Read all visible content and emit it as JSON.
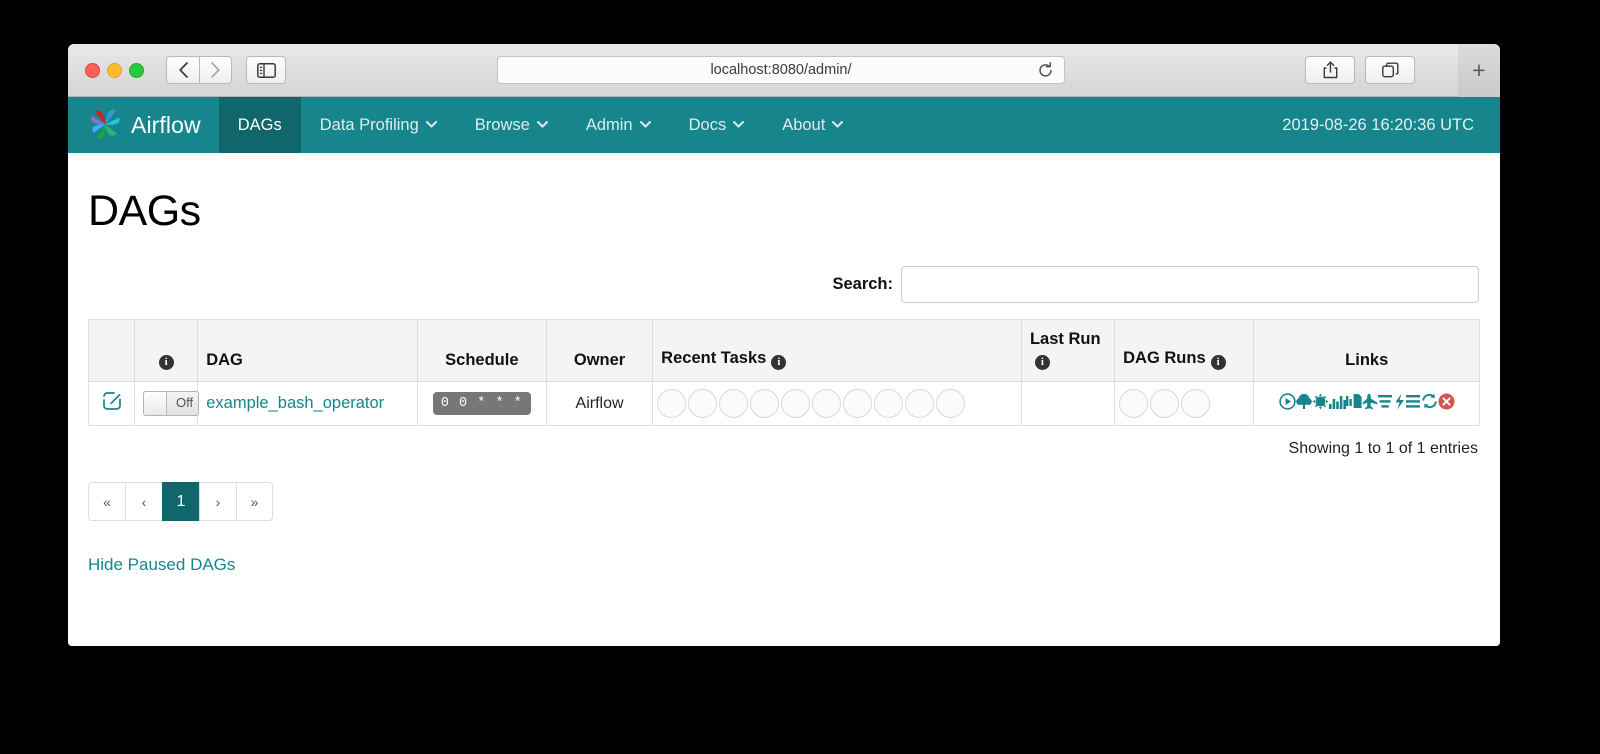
{
  "browser": {
    "url": "localhost:8080/admin/",
    "back_icon": "chevron-left-icon",
    "forward_icon": "chevron-right-icon",
    "sidebar_icon": "sidebar-toggle-icon",
    "reload_icon": "reload-icon",
    "share_icon": "share-icon",
    "tabs_icon": "show-tabs-icon",
    "newtab_label": "+"
  },
  "navbar": {
    "brand": "Airflow",
    "brand_logo": "airflow-pinwheel-logo",
    "clock": "2019-08-26 16:20:36 UTC",
    "items": [
      {
        "label": "DAGs",
        "has_caret": false,
        "active": true
      },
      {
        "label": "Data Profiling",
        "has_caret": true,
        "active": false
      },
      {
        "label": "Browse",
        "has_caret": true,
        "active": false
      },
      {
        "label": "Admin",
        "has_caret": true,
        "active": false
      },
      {
        "label": "Docs",
        "has_caret": true,
        "active": false
      },
      {
        "label": "About",
        "has_caret": true,
        "active": false
      }
    ],
    "caret_glyph": "⌄"
  },
  "page": {
    "title": "DAGs",
    "search_label": "Search:",
    "search_value": "",
    "search_placeholder": "",
    "showing_text": "Showing 1 to 1 of 1 entries",
    "hide_paused_label": "Hide Paused DAGs"
  },
  "table": {
    "headers": [
      {
        "label": "",
        "info": false,
        "align": "center"
      },
      {
        "label": "",
        "info": true,
        "align": "center"
      },
      {
        "label": "DAG",
        "info": false,
        "align": "left"
      },
      {
        "label": "Schedule",
        "info": false,
        "align": "center"
      },
      {
        "label": "Owner",
        "info": false,
        "align": "center"
      },
      {
        "label": "Recent Tasks",
        "info": true,
        "align": "left"
      },
      {
        "label": "Last Run",
        "info": true,
        "align": "left"
      },
      {
        "label": "DAG Runs",
        "info": true,
        "align": "left"
      },
      {
        "label": "Links",
        "info": false,
        "align": "center"
      }
    ],
    "rows": [
      {
        "edit_icon": "edit-pencil-icon",
        "toggle_label": "Off",
        "toggle_state": "off",
        "dag_name": "example_bash_operator",
        "schedule": "0 0 * * *",
        "owner": "Airflow",
        "recent_tasks_count": 10,
        "last_run": "",
        "dag_runs_count": 3,
        "links": [
          {
            "name": "trigger-dag-icon",
            "danger": false
          },
          {
            "name": "tree-view-icon",
            "danger": false
          },
          {
            "name": "graph-view-icon",
            "danger": false
          },
          {
            "name": "task-duration-icon",
            "danger": false
          },
          {
            "name": "task-tries-icon",
            "danger": false
          },
          {
            "name": "landing-times-icon",
            "danger": false
          },
          {
            "name": "gantt-icon",
            "danger": false
          },
          {
            "name": "code-icon",
            "danger": false
          },
          {
            "name": "logs-icon",
            "danger": false
          },
          {
            "name": "refresh-icon",
            "danger": false
          },
          {
            "name": "delete-dag-icon",
            "danger": true
          }
        ]
      }
    ]
  },
  "pagination": {
    "first_label": "«",
    "prev_label": "‹",
    "pages": [
      "1"
    ],
    "next_label": "›",
    "last_label": "»",
    "current": "1"
  },
  "colors": {
    "brand_teal": "#17858c",
    "active_teal": "#11666c",
    "link_teal": "#17858c",
    "danger_red": "#d9534f",
    "schedule_badge_gray": "#777777"
  }
}
